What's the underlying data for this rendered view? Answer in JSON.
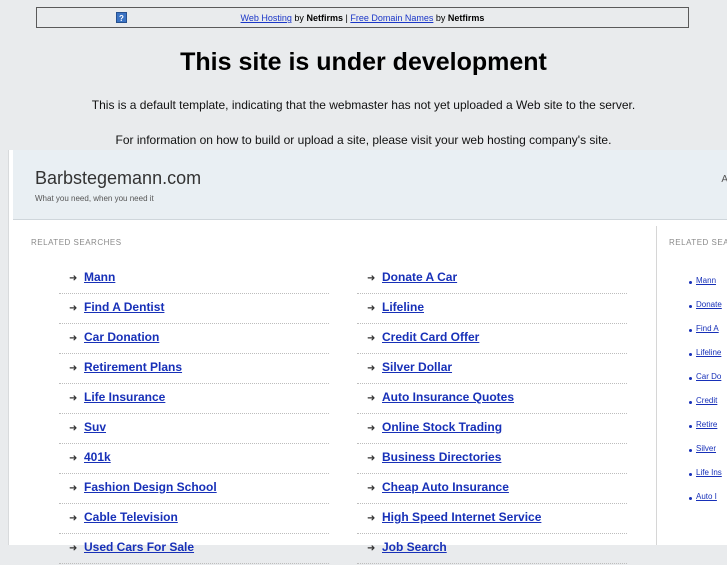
{
  "topbar": {
    "link1": "Web Hosting",
    "by1": "by",
    "brand1": "Netfirms",
    "sep": "|",
    "link2": "Free Domain Names",
    "by2": "by",
    "brand2": "Netfirms",
    "help_icon": "?"
  },
  "headline": "This site is under development",
  "info1": "This is a default template, indicating that the webmaster has not yet uploaded a Web site to the server.",
  "info2": "For information on how to build or upload a site, please visit your web hosting company's site.",
  "site": {
    "title": "Barbstegemann.com",
    "tagline": "What you need, when you need it",
    "edge_mark": "A"
  },
  "related": {
    "label": "RELATED SEARCHES",
    "arrow": "➜",
    "left": [
      "Mann",
      "Find A Dentist",
      "Car Donation",
      "Retirement Plans",
      "Life Insurance",
      "Suv",
      "401k",
      "Fashion Design School",
      "Cable Television",
      "Used Cars For Sale"
    ],
    "right": [
      "Donate A Car",
      "Lifeline",
      "Credit Card Offer",
      "Silver Dollar",
      "Auto Insurance Quotes",
      "Online Stock Trading",
      "Business Directories",
      "Cheap Auto Insurance",
      "High Speed Internet Service",
      "Job Search"
    ]
  },
  "sidebar": {
    "label": "RELATED SEA",
    "items": [
      "Mann",
      "Donate",
      "Find A",
      "Lifeline",
      "Car Do",
      "Credit",
      "Retire",
      "Silver",
      "Life Ins",
      "Auto I"
    ]
  }
}
